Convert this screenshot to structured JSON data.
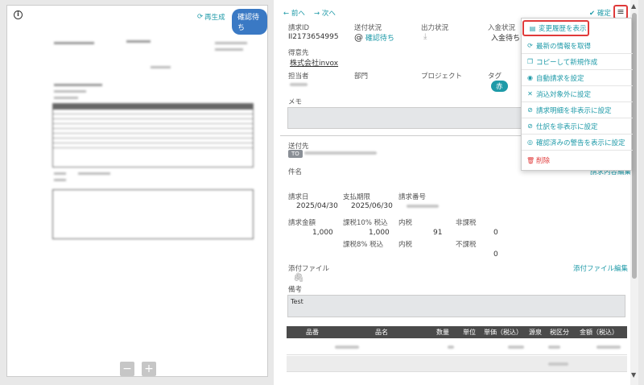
{
  "preview": {
    "regen_label": "再生成",
    "status_badge": "確認待ち",
    "zoom_minus": "−",
    "zoom_plus": "+"
  },
  "nav": {
    "prev": "前へ",
    "next": "次へ",
    "confirm": "確定"
  },
  "invoice": {
    "labels": {
      "id": "請求ID",
      "send_status": "送付状況",
      "output_status": "出力状況",
      "payment_status": "入金状況",
      "customer": "得意先",
      "owner": "担当者",
      "dept": "部門",
      "project": "プロジェクト",
      "tag": "タグ",
      "memo": "メモ",
      "send_to": "送付先",
      "subject": "件名",
      "invoice_date": "請求日",
      "due_date": "支払期限",
      "invoice_no": "請求番号",
      "amount": "請求金額",
      "tax10": "課税10% 税込",
      "tax8": "課税8% 税込",
      "incl_tax_1": "内税",
      "incl_tax_2": "内税",
      "non_taxable": "非課税",
      "tax_exempt": "不課税",
      "attachments": "添付ファイル",
      "remarks": "備考"
    },
    "id": "II2173654995",
    "send_status": "確認待ち",
    "payment_status": "入金待ち",
    "customer": "株式会社invox",
    "tag": "赤",
    "to_badge": "TO",
    "invoice_date": "2025/04/30",
    "due_date": "2025/06/30",
    "amount": "1,000",
    "tax10_amount": "1,000",
    "tax10_inner": "91",
    "non_taxable_amount": "0",
    "tax_exempt_amount": "0",
    "remarks": "Test",
    "edit_contents": "請求内容編集",
    "edit_attachments": "添付ファイル編集"
  },
  "items_table": {
    "headers": [
      "品番",
      "品名",
      "数量",
      "単位",
      "単価（税込）",
      "源泉",
      "税区分",
      "金額（税込）"
    ]
  },
  "menu": {
    "items": [
      {
        "label": "変更履歴を表示",
        "icon": "document-icon"
      },
      {
        "label": "最新の情報を取得",
        "icon": "refresh-icon"
      },
      {
        "label": "コピーして新規作成",
        "icon": "copy-icon"
      },
      {
        "label": "自動請求を設定",
        "icon": "auto-icon"
      },
      {
        "label": "消込対象外に設定",
        "icon": "x-icon"
      },
      {
        "label": "請求明細を非表示に設定",
        "icon": "eye-slash-icon"
      },
      {
        "label": "仕訳を非表示に設定",
        "icon": "eye-slash-icon"
      },
      {
        "label": "確認済みの警告を表示に設定",
        "icon": "eye-icon"
      },
      {
        "label": "削除",
        "icon": "trash-icon"
      }
    ]
  },
  "colors": {
    "accent": "#1e9aa8",
    "badge_blue": "#3a79c4",
    "highlight_red": "#e03a3a",
    "table_header": "#4a4a4a"
  }
}
